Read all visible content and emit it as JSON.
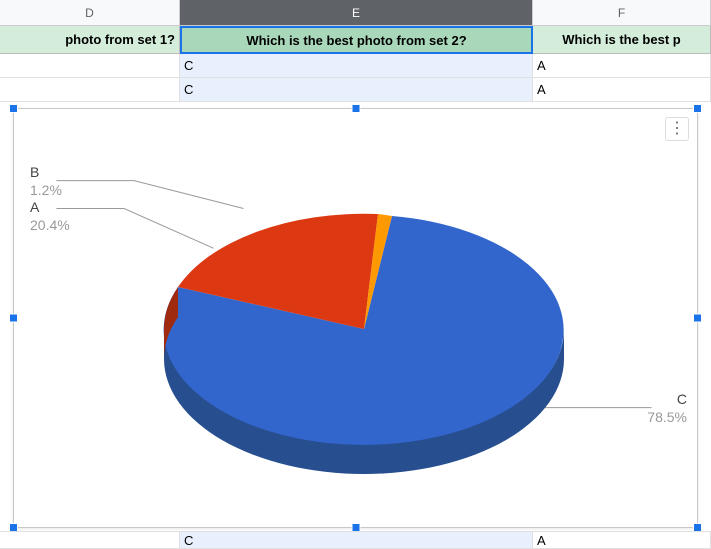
{
  "columns": {
    "D": {
      "label": "D",
      "header": "photo from set 1?"
    },
    "E": {
      "label": "E",
      "header": "Which is the best photo from set 2?",
      "selected": true
    },
    "F": {
      "label": "F",
      "header": "Which is the best p"
    }
  },
  "rows": [
    {
      "D": "",
      "E": "C",
      "F": "A"
    },
    {
      "D": "",
      "E": "C",
      "F": "A"
    }
  ],
  "bottom_row": {
    "E": "C",
    "F": "A"
  },
  "chart_menu_glyph": "⋮",
  "chart_data": {
    "type": "pie",
    "title": "",
    "series": [
      {
        "name": "C",
        "value": 78.5,
        "label": "78.5%",
        "color": "#3366cc"
      },
      {
        "name": "A",
        "value": 20.4,
        "label": "20.4%",
        "color": "#dc3912"
      },
      {
        "name": "B",
        "value": 1.2,
        "label": "1.2%",
        "color": "#ff9900"
      }
    ]
  }
}
